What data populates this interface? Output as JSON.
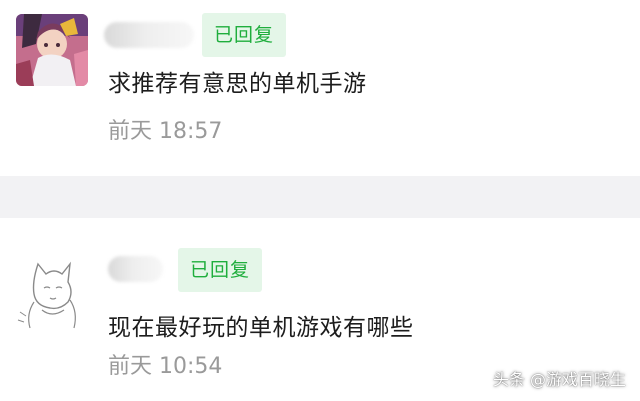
{
  "comments": [
    {
      "badge": "已回复",
      "text": "求推荐有意思的单机手游",
      "time": "前天 18:57"
    },
    {
      "badge": "已回复",
      "text": "现在最好玩的单机游戏有哪些",
      "time": "前天 10:54"
    }
  ],
  "watermark": "头条 @游戏百晓生",
  "colors": {
    "badge_bg": "#e4f6e8",
    "badge_text": "#1fae3d",
    "divider": "#f2f2f4",
    "time_text": "#9a9a9a"
  }
}
